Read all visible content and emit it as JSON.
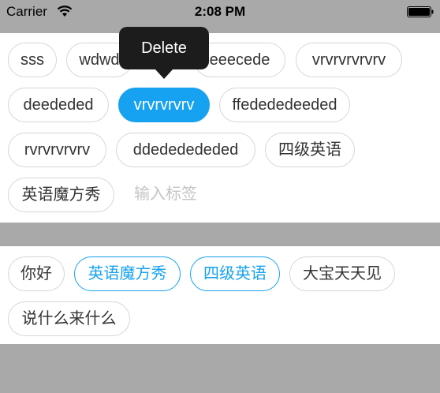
{
  "status_bar": {
    "carrier": "Carrier",
    "time": "2:08 PM",
    "wifi_icon": "wifi-icon",
    "battery_icon": "battery-icon"
  },
  "colors": {
    "accent": "#16a2f0",
    "background": "#a9a9a9",
    "tag_border": "#d6d6d6",
    "tooltip": "#1c1c1c"
  },
  "tag_editor": {
    "tags": [
      {
        "label": "sss",
        "state": "normal"
      },
      {
        "label": "wdwd",
        "state": "normal"
      },
      {
        "label": "eeecede",
        "state": "normal"
      },
      {
        "label": "vrvrvrvrvrv",
        "state": "normal"
      },
      {
        "label": "deededed",
        "state": "normal"
      },
      {
        "label": "vrvrvrvrv",
        "state": "selected"
      },
      {
        "label": "ffedededeeded",
        "state": "normal"
      },
      {
        "label": "rvrvrvrvrv",
        "state": "normal"
      },
      {
        "label": "ddededededed",
        "state": "normal"
      },
      {
        "label": "四级英语",
        "state": "normal"
      },
      {
        "label": "英语魔方秀",
        "state": "normal"
      }
    ],
    "input_placeholder": "输入标签",
    "tooltip_label": "Delete"
  },
  "suggested_tags": [
    {
      "label": "你好",
      "state": "normal"
    },
    {
      "label": "英语魔方秀",
      "state": "added"
    },
    {
      "label": "四级英语",
      "state": "added"
    },
    {
      "label": "大宝天天见",
      "state": "normal"
    },
    {
      "label": "说什么来什么",
      "state": "normal"
    }
  ]
}
